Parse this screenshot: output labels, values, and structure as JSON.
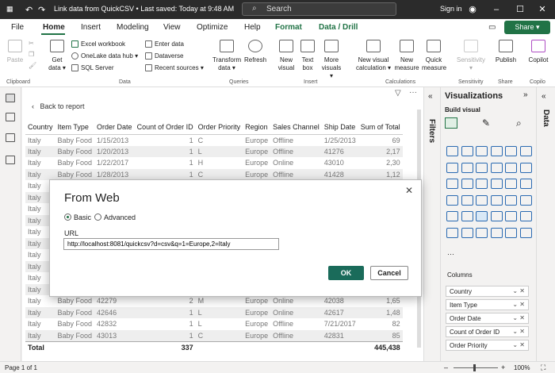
{
  "titlebar": {
    "title": "Link data from QuickCSV • Last saved: Today at 9:48 AM",
    "search": "Search",
    "signin": "Sign in"
  },
  "menu": {
    "tabs": [
      "File",
      "Home",
      "Insert",
      "Modeling",
      "View",
      "Optimize",
      "Help",
      "Format",
      "Data / Drill"
    ],
    "share": "Share"
  },
  "ribbon": {
    "paste": "Paste",
    "get_data": "Get data",
    "excel": "Excel workbook",
    "onelake": "OneLake data hub",
    "sql": "SQL Server",
    "enter_data": "Enter data",
    "dataverse": "Dataverse",
    "recent": "Recent sources",
    "transform": "Transform data",
    "refresh": "Refresh",
    "new_visual": "New visual",
    "text_box": "Text box",
    "more_visuals": "More visuals",
    "new_visual_calc": "New visual calculation",
    "new_measure": "New measure",
    "quick_measure": "Quick measure",
    "sensitivity": "Sensitivity",
    "publish": "Publish",
    "copilot": "Copilot",
    "groups": [
      "Clipboard",
      "Data",
      "Queries",
      "Insert",
      "Calculations",
      "Sensitivity",
      "Share",
      "Copilo"
    ]
  },
  "canvas": {
    "back": "Back to report",
    "columns": [
      "Country",
      "Item Type",
      "Order Date",
      "Count of Order ID",
      "Order Priority",
      "Region",
      "Sales Channel",
      "Ship Date",
      "Sum of Total"
    ],
    "rows": [
      [
        "Italy",
        "Baby Food",
        "1/15/2013",
        "1",
        "C",
        "Europe",
        "Offline",
        "1/25/2013",
        "69"
      ],
      [
        "Italy",
        "Baby Food",
        "1/20/2013",
        "1",
        "L",
        "Europe",
        "Offline",
        "41276",
        "2,17"
      ],
      [
        "Italy",
        "Baby Food",
        "1/22/2017",
        "1",
        "H",
        "Europe",
        "Online",
        "43010",
        "2,30"
      ],
      [
        "Italy",
        "Baby Food",
        "1/28/2013",
        "1",
        "C",
        "Europe",
        "Offline",
        "41428",
        "1,12"
      ],
      [
        "Italy",
        "",
        "",
        "",
        "",
        "",
        "",
        "",
        ""
      ],
      [
        "Italy",
        "",
        "",
        "",
        "",
        "",
        "",
        "",
        ""
      ],
      [
        "Italy",
        "",
        "",
        "",
        "",
        "",
        "",
        "",
        ""
      ],
      [
        "Italy",
        "",
        "",
        "",
        "",
        "",
        "",
        "",
        ""
      ],
      [
        "Italy",
        "",
        "",
        "",
        "",
        "",
        "",
        "",
        ""
      ],
      [
        "Italy",
        "",
        "",
        "",
        "",
        "",
        "",
        "",
        ""
      ],
      [
        "Italy",
        "",
        "",
        "",
        "",
        "",
        "",
        "",
        ""
      ],
      [
        "Italy",
        "",
        "",
        "",
        "",
        "",
        "",
        "",
        ""
      ],
      [
        "Italy",
        "",
        "",
        "",
        "",
        "",
        "",
        "",
        ""
      ],
      [
        "Italy",
        "",
        "",
        "",
        "",
        "",
        "",
        "",
        ""
      ],
      [
        "Italy",
        "Baby Food",
        "42279",
        "2",
        "M",
        "Europe",
        "Online",
        "42038",
        "1,65"
      ],
      [
        "Italy",
        "Baby Food",
        "42646",
        "1",
        "L",
        "Europe",
        "Online",
        "42617",
        "1,48"
      ],
      [
        "Italy",
        "Baby Food",
        "42832",
        "1",
        "L",
        "Europe",
        "Offline",
        "7/21/2017",
        "82"
      ],
      [
        "Italy",
        "Baby Food",
        "43013",
        "1",
        "C",
        "Europe",
        "Offline",
        "42831",
        "85"
      ]
    ],
    "total": [
      "Total",
      "",
      "",
      "337",
      "",
      "",
      "",
      "",
      "445,438"
    ]
  },
  "filters": {
    "label": "Filters"
  },
  "viz": {
    "title": "Visualizations",
    "build": "Build visual",
    "columns_label": "Columns",
    "wells": [
      "Country",
      "Item Type",
      "Order Date",
      "Count of Order ID",
      "Order Priority"
    ]
  },
  "datapane": {
    "label": "Data"
  },
  "status": {
    "page": "Page 1 of 1",
    "zoom": "100%"
  },
  "dialog": {
    "title": "From Web",
    "basic": "Basic",
    "advanced": "Advanced",
    "url_label": "URL",
    "url_value": "http://localhost:8081/quickcsv?d=csv&q=1=Europe,2=Italy",
    "ok": "OK",
    "cancel": "Cancel"
  }
}
